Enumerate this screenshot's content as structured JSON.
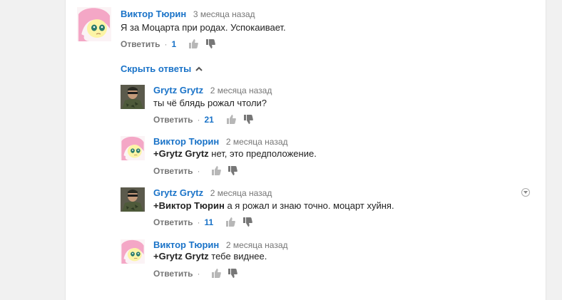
{
  "comments": [
    {
      "author": "Виктор Тюрин",
      "time": "3 месяца назад",
      "mention": "",
      "text": "Я за Моцарта при родах. Успокаивает.",
      "reply_label": "Ответить",
      "likes": "1",
      "avatar": "pink-pony-avatar"
    }
  ],
  "hide_replies_label": "Скрыть ответы",
  "replies": [
    {
      "author": "Grytz Grytz",
      "time": "2 месяца назад",
      "mention": "",
      "text": "ты чё блядь рожал чтоли?",
      "reply_label": "Ответить",
      "likes": "21",
      "avatar": "soldier-avatar"
    },
    {
      "author": "Виктор Тюрин",
      "time": "2 месяца назад",
      "mention": "+Grytz Grytz",
      "text": " нет, это предположение.",
      "reply_label": "Ответить",
      "likes": "",
      "avatar": "pink-pony-avatar"
    },
    {
      "author": "Grytz Grytz",
      "time": "2 месяца назад",
      "mention": "+Виктор Тюрин",
      "text": " а я рожал и знаю точно. моцарт хуйня.",
      "reply_label": "Ответить",
      "likes": "11",
      "avatar": "soldier-avatar"
    },
    {
      "author": "Виктор Тюрин",
      "time": "2 месяца назад",
      "mention": "+Grytz Grytz",
      "text": " тебе виднее.",
      "reply_label": "Ответить",
      "likes": "",
      "avatar": "pink-pony-avatar"
    }
  ],
  "colors": {
    "link": "#1a73c8",
    "meta": "#767676",
    "text": "#222222",
    "page_bg": "#f1f1f1"
  }
}
